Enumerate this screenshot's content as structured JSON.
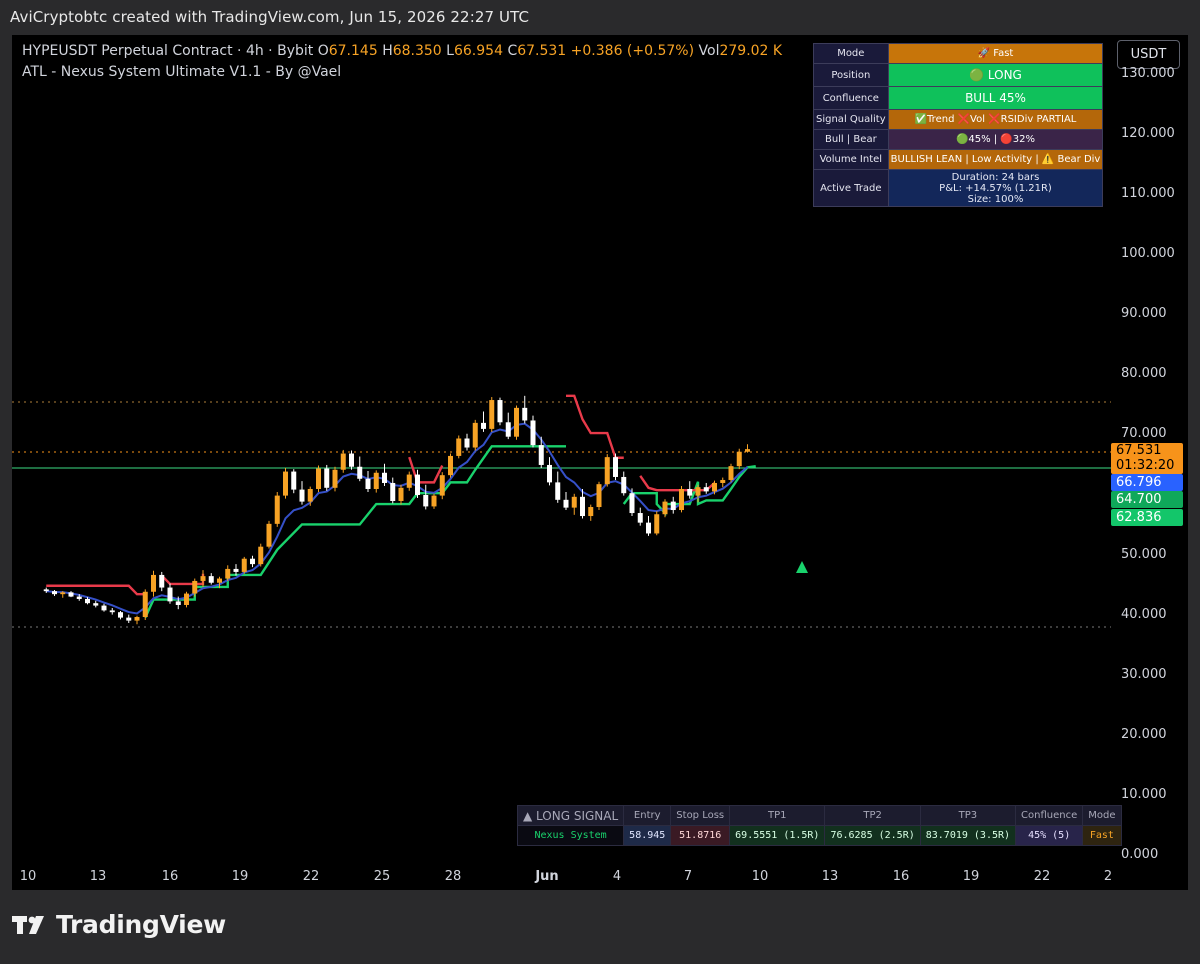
{
  "caption": "AviCryptobtc created with TradingView.com, Jun 15, 2026 22:27 UTC",
  "legend": {
    "symbol_line": "HYPEUSDT Perpetual Contract · 4h · Bybit",
    "o_label": "O",
    "o_value": "67.145",
    "h_label": "H",
    "h_value": "68.350",
    "l_label": "L",
    "l_value": "66.954",
    "c_label": "C",
    "c_value": "67.531",
    "change": "+0.386 (+0.57%)",
    "vol_label": "Vol",
    "vol_value": "279.02 K",
    "indicator": "ATL - Nexus System Ultimate V1.1 - By @Vael"
  },
  "currency_button": "USDT",
  "colors": {
    "up_candle": "#f7a325",
    "down_candle": "#ffffff",
    "trail_bull": "#19d26c",
    "trail_bear": "#e83a4a",
    "ema": "#3550c8",
    "accent_orange": "#f7931a",
    "tag_blue": "#2962ff",
    "tag_green": "#13b866"
  },
  "y_axis": {
    "ticks": [
      "130.000",
      "120.000",
      "110.000",
      "100.000",
      "90.000",
      "80.000",
      "70.000",
      "50.000",
      "40.000",
      "30.000",
      "20.000",
      "10.000",
      "0.000"
    ]
  },
  "price_tags": {
    "last_price": "67.531",
    "countdown": "01:32:20",
    "ema_value": "66.796",
    "level_a": "64.700",
    "level_b": "62.836"
  },
  "x_axis": {
    "ticks": [
      {
        "label": "10",
        "bold": false
      },
      {
        "label": "13",
        "bold": false
      },
      {
        "label": "16",
        "bold": false
      },
      {
        "label": "19",
        "bold": false
      },
      {
        "label": "22",
        "bold": false
      },
      {
        "label": "25",
        "bold": false
      },
      {
        "label": "28",
        "bold": false
      },
      {
        "label": "Jun",
        "bold": true
      },
      {
        "label": "4",
        "bold": false
      },
      {
        "label": "7",
        "bold": false
      },
      {
        "label": "10",
        "bold": false
      },
      {
        "label": "13",
        "bold": false
      },
      {
        "label": "16",
        "bold": false
      },
      {
        "label": "19",
        "bold": false
      },
      {
        "label": "22",
        "bold": false
      },
      {
        "label": "2",
        "bold": false
      }
    ]
  },
  "status_panel": {
    "rows": [
      {
        "key": "Mode",
        "value": "🚀 Fast",
        "bg": "#c7750a",
        "fg": "#ffffff"
      },
      {
        "key": "Position",
        "value": "🟢 LONG",
        "bg": "#0fc15b",
        "fg": "#ffffff"
      },
      {
        "key": "Confluence",
        "value": "BULL 45%",
        "bg": "#0fc15b",
        "fg": "#ffffff"
      },
      {
        "key": "Signal Quality",
        "value": "✅Trend ❌Vol ❌RSIDiv PARTIAL",
        "bg": "#b4670a",
        "fg": "#ffffff"
      },
      {
        "key": "Bull | Bear",
        "value": "🟢45% | 🔴32%",
        "bg": "#3a2448",
        "fg": "#ffffff"
      },
      {
        "key": "Volume Intel",
        "value": "BULLISH LEAN | Low Activity | ⚠️ Bear Div",
        "bg": "#b4670a",
        "fg": "#ffffff"
      }
    ],
    "active_trade": {
      "key": "Active Trade",
      "lines": [
        "Duration: 24 bars",
        "P&L: +14.57% (1.21R)",
        "Size: 100%"
      ],
      "bg": "#13275a"
    }
  },
  "signal_table": {
    "title": "▲ LONG SIGNAL",
    "row_label": "Nexus System",
    "columns": [
      {
        "header": "Entry",
        "value": "58.945",
        "bg": "#1e2a48",
        "fg": "#e0e6ff"
      },
      {
        "header": "Stop Loss",
        "value": "51.8716",
        "bg": "#3a1a24",
        "fg": "#ffd8d8"
      },
      {
        "header": "TP1",
        "value": "69.5551 (1.5R)",
        "bg": "#12301e",
        "fg": "#d8ffe4"
      },
      {
        "header": "TP2",
        "value": "76.6285 (2.5R)",
        "bg": "#12301e",
        "fg": "#d8ffe4"
      },
      {
        "header": "TP3",
        "value": "83.7019 (3.5R)",
        "bg": "#12301e",
        "fg": "#d8ffe4"
      },
      {
        "header": "Confluence",
        "value": "45% (5)",
        "bg": "#28244a",
        "fg": "#e6e0ff"
      },
      {
        "header": "Mode",
        "value": "Fast",
        "bg": "#2e2410",
        "fg": "#f7a325"
      }
    ]
  },
  "brand": "TradingView",
  "chart_data": {
    "type": "line",
    "ylim": [
      0,
      135
    ],
    "series_candles_ohlc": [
      [
        44.2,
        44.5,
        43.6,
        43.9
      ],
      [
        43.9,
        44.1,
        43.1,
        43.4
      ],
      [
        43.4,
        43.9,
        42.8,
        43.7
      ],
      [
        43.7,
        43.9,
        42.9,
        43.0
      ],
      [
        43.0,
        43.4,
        42.3,
        42.6
      ],
      [
        42.6,
        42.9,
        41.7,
        41.9
      ],
      [
        41.9,
        42.3,
        41.2,
        41.5
      ],
      [
        41.5,
        41.8,
        40.5,
        40.7
      ],
      [
        40.7,
        41.1,
        40.0,
        40.4
      ],
      [
        40.4,
        40.6,
        39.2,
        39.5
      ],
      [
        39.5,
        40.0,
        38.6,
        39.0
      ],
      [
        39.0,
        39.8,
        38.4,
        39.6
      ],
      [
        39.6,
        44.2,
        39.1,
        43.8
      ],
      [
        43.8,
        47.3,
        43.0,
        46.6
      ],
      [
        46.6,
        47.1,
        43.9,
        44.5
      ],
      [
        44.5,
        45.2,
        41.8,
        42.2
      ],
      [
        42.2,
        43.0,
        40.9,
        41.6
      ],
      [
        41.6,
        43.8,
        41.2,
        43.5
      ],
      [
        43.5,
        46.0,
        43.0,
        45.6
      ],
      [
        45.6,
        47.4,
        44.6,
        46.4
      ],
      [
        46.4,
        46.9,
        45.0,
        45.3
      ],
      [
        45.3,
        46.3,
        44.4,
        46.0
      ],
      [
        46.0,
        48.2,
        45.6,
        47.6
      ],
      [
        47.6,
        48.4,
        46.5,
        47.1
      ],
      [
        47.1,
        49.6,
        46.8,
        49.3
      ],
      [
        49.3,
        49.8,
        47.9,
        48.4
      ],
      [
        48.4,
        51.8,
        48.0,
        51.3
      ],
      [
        51.3,
        55.6,
        51.0,
        55.1
      ],
      [
        55.1,
        60.4,
        54.6,
        59.8
      ],
      [
        59.8,
        64.4,
        59.3,
        63.8
      ],
      [
        63.8,
        64.2,
        60.2,
        60.8
      ],
      [
        60.8,
        62.2,
        58.3,
        58.8
      ],
      [
        58.8,
        61.3,
        58.1,
        60.9
      ],
      [
        60.9,
        64.8,
        60.4,
        64.3
      ],
      [
        64.3,
        64.9,
        60.6,
        61.1
      ],
      [
        61.1,
        64.6,
        60.5,
        64.1
      ],
      [
        64.1,
        67.4,
        63.6,
        66.8
      ],
      [
        66.8,
        67.3,
        64.1,
        64.6
      ],
      [
        64.6,
        66.3,
        62.2,
        62.6
      ],
      [
        62.6,
        63.9,
        60.4,
        60.9
      ],
      [
        60.9,
        64.0,
        60.3,
        63.6
      ],
      [
        63.6,
        65.1,
        61.4,
        61.9
      ],
      [
        61.9,
        62.8,
        58.5,
        58.9
      ],
      [
        58.9,
        61.6,
        58.3,
        61.1
      ],
      [
        61.1,
        63.8,
        60.6,
        63.3
      ],
      [
        63.3,
        64.1,
        59.4,
        59.9
      ],
      [
        59.9,
        61.6,
        57.5,
        58.0
      ],
      [
        58.0,
        60.1,
        57.6,
        59.8
      ],
      [
        59.8,
        63.7,
        59.2,
        63.2
      ],
      [
        63.2,
        66.8,
        62.8,
        66.4
      ],
      [
        66.4,
        69.8,
        66.0,
        69.3
      ],
      [
        69.3,
        70.1,
        67.3,
        67.8
      ],
      [
        67.8,
        72.4,
        67.3,
        71.9
      ],
      [
        71.9,
        73.8,
        70.4,
        70.9
      ],
      [
        70.9,
        76.2,
        70.4,
        75.7
      ],
      [
        75.7,
        76.1,
        71.5,
        72.0
      ],
      [
        72.0,
        73.6,
        69.2,
        69.6
      ],
      [
        69.6,
        74.8,
        69.1,
        74.4
      ],
      [
        74.4,
        76.4,
        71.8,
        72.3
      ],
      [
        72.3,
        73.1,
        67.8,
        68.2
      ],
      [
        68.2,
        69.6,
        64.4,
        64.9
      ],
      [
        64.9,
        66.2,
        61.5,
        62.0
      ],
      [
        62.0,
        63.8,
        58.6,
        59.1
      ],
      [
        59.1,
        60.4,
        57.4,
        57.8
      ],
      [
        57.8,
        60.1,
        56.6,
        59.6
      ],
      [
        59.6,
        60.9,
        56.0,
        56.4
      ],
      [
        56.4,
        58.3,
        55.6,
        57.9
      ],
      [
        57.9,
        62.1,
        57.4,
        61.7
      ],
      [
        61.7,
        66.7,
        61.3,
        66.2
      ],
      [
        66.2,
        66.8,
        62.4,
        62.9
      ],
      [
        62.9,
        63.8,
        59.8,
        60.2
      ],
      [
        60.2,
        61.0,
        56.4,
        56.9
      ],
      [
        56.9,
        57.8,
        54.8,
        55.3
      ],
      [
        55.3,
        56.4,
        53.1,
        53.5
      ],
      [
        53.5,
        57.2,
        53.2,
        56.7
      ],
      [
        56.7,
        59.2,
        56.2,
        58.8
      ],
      [
        58.8,
        59.6,
        56.8,
        57.4
      ],
      [
        57.4,
        61.4,
        57.0,
        60.9
      ],
      [
        60.9,
        62.2,
        59.3,
        59.8
      ],
      [
        59.8,
        61.6,
        58.7,
        61.2
      ],
      [
        61.2,
        61.9,
        60.1,
        60.5
      ],
      [
        60.5,
        62.3,
        60.0,
        61.9
      ],
      [
        61.9,
        62.8,
        61.2,
        62.4
      ],
      [
        62.4,
        65.1,
        62.0,
        64.7
      ],
      [
        64.7,
        67.6,
        64.2,
        67.1
      ],
      [
        67.1,
        68.35,
        66.95,
        67.531
      ]
    ],
    "candle_x_range": [
      0,
      85
    ]
  }
}
